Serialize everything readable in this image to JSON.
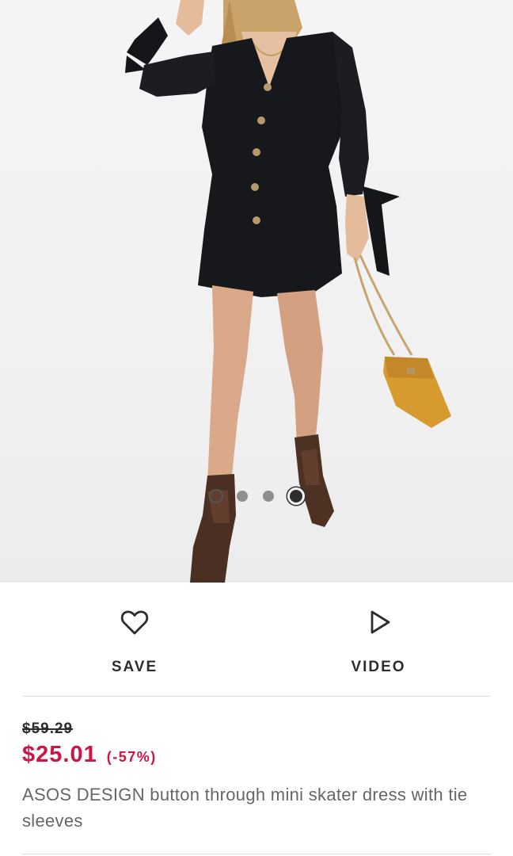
{
  "gallery": {
    "slides": [
      "slide-1",
      "slide-2",
      "slide-3",
      "slide-4"
    ],
    "active_index": 4
  },
  "actions": {
    "save_label": "SAVE",
    "save_icon": "heart-outline-icon",
    "video_label": "VIDEO",
    "video_icon": "play-outline-icon"
  },
  "product": {
    "old_price": "$59.29",
    "price": "$25.01",
    "discount": "(-57%)",
    "title": "ASOS DESIGN button through mini skater dress with tie sleeves"
  },
  "colors": {
    "sale_red": "#d01345",
    "text_dark": "#2d2d2d",
    "text_muted": "#666666",
    "divider": "#dcdcdc"
  }
}
